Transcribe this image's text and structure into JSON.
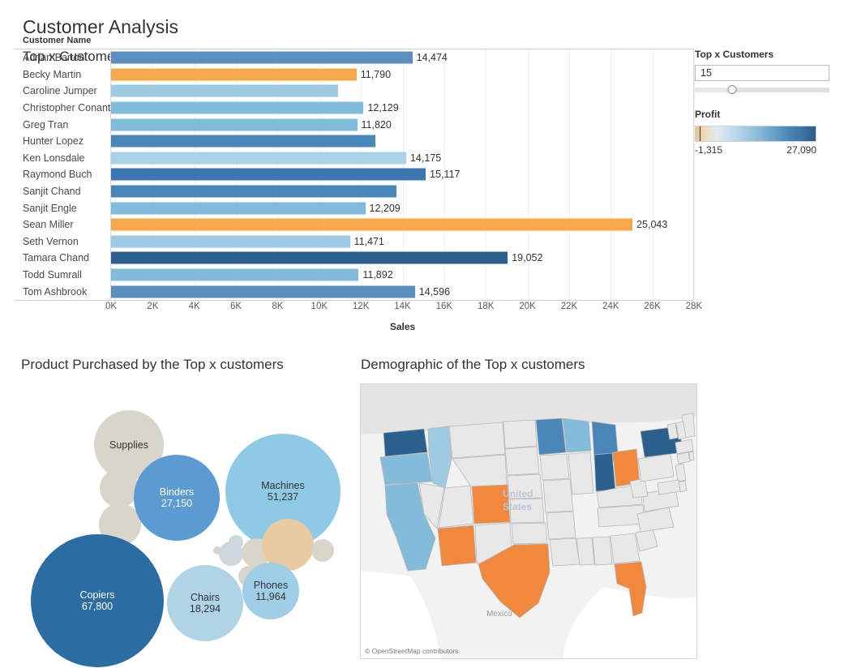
{
  "dashboard": {
    "title": "Customer Analysis"
  },
  "bar_panel": {
    "title": "Top x Customers",
    "column_header": "Customer Name",
    "axis_title": "Sales"
  },
  "controls": {
    "parameter_label": "Top x Customers",
    "parameter_value": "15",
    "legend_label": "Profit",
    "legend_min": "-1,315",
    "legend_max": "27,090"
  },
  "bubble_panel": {
    "title": "Product Purchased by the Top x customers"
  },
  "map_panel": {
    "title": "Demographic of the Top x customers",
    "attribution": "© OpenStreetMap contributors",
    "country_label_line1": "United",
    "country_label_line2": "States",
    "mexico_label": "Mexico"
  },
  "chart_data": [
    {
      "type": "bar",
      "title": "Top x Customers",
      "xlabel": "Sales",
      "ylabel": "Customer Name",
      "xlim": [
        0,
        28000
      ],
      "grid": true,
      "orientation": "horizontal",
      "ticks": [
        "0K",
        "2K",
        "4K",
        "6K",
        "8K",
        "10K",
        "12K",
        "14K",
        "16K",
        "18K",
        "20K",
        "22K",
        "24K",
        "26K",
        "28K"
      ],
      "tick_values": [
        0,
        2000,
        4000,
        6000,
        8000,
        10000,
        12000,
        14000,
        16000,
        18000,
        20000,
        22000,
        24000,
        26000,
        28000
      ],
      "color_encoding": "Profit",
      "categories": [
        "Adrian Barton",
        "Becky Martin",
        "Caroline Jumper",
        "Christopher Conant",
        "Greg Tran",
        "Hunter Lopez",
        "Ken Lonsdale",
        "Raymond Buch",
        "Sanjit Chand",
        "Sanjit Engle",
        "Sean Miller",
        "Seth Vernon",
        "Tamara Chand",
        "Todd Sumrall",
        "Tom Ashbrook"
      ],
      "values": [
        14474,
        11790,
        10900,
        12129,
        11820,
        12700,
        14175,
        15117,
        13700,
        12209,
        25043,
        11471,
        19052,
        11892,
        14596
      ],
      "labels": [
        "14,474",
        "11,790",
        "",
        "12,129",
        "11,820",
        "",
        "14,175",
        "15,117",
        "",
        "12,209",
        "25,043",
        "11,471",
        "19,052",
        "11,892",
        "14,596"
      ],
      "colors": [
        "#5b8fc0",
        "#f5a council",
        "#9ecae3",
        "#82bcdb",
        "#82bcdb",
        "#4a86b8",
        "#a8d3e8",
        "#3a77ae",
        "#4a86b8",
        "#82bcdb",
        "#f7a84a",
        "#9ecae3",
        "#2b5f8e",
        "#82bcdb",
        "#5b8fc0"
      ],
      "bar_colors": [
        "#5b8fc0",
        "#f7a84a",
        "#9ecae3",
        "#82bcdb",
        "#82bcdb",
        "#4a86b8",
        "#a8d3e8",
        "#3a77ae",
        "#4a86b8",
        "#82bcdb",
        "#f7a84a",
        "#9ecae3",
        "#2b5f8e",
        "#82bcdb",
        "#5b8fc0"
      ]
    },
    {
      "type": "bubble",
      "title": "Product Purchased by the Top x customers",
      "labeled_bubbles": [
        {
          "name": "Copiers",
          "value": 67800,
          "label": "67,800",
          "color": "#2b6ca3"
        },
        {
          "name": "Machines",
          "value": 51237,
          "label": "51,237",
          "color": "#8ecae6"
        },
        {
          "name": "Binders",
          "value": 27150,
          "label": "27,150",
          "color": "#5b9bd1"
        },
        {
          "name": "Chairs",
          "value": 18294,
          "label": "18,294",
          "color": "#aed4e6"
        },
        {
          "name": "Phones",
          "value": 11964,
          "label": "11,964",
          "color": "#9ecfe6"
        },
        {
          "name": "Supplies",
          "value": 0,
          "label": "",
          "color": "#d8d5cb"
        }
      ]
    },
    {
      "type": "map",
      "title": "Demographic of the Top x customers",
      "region": "United States",
      "color_encoding": "Profit",
      "states": [
        {
          "code": "WA",
          "color": "#2b5f8e"
        },
        {
          "code": "NY",
          "color": "#2b5f8e"
        },
        {
          "code": "IN",
          "color": "#2b5f8e"
        },
        {
          "code": "MN",
          "color": "#4a86b8"
        },
        {
          "code": "MI",
          "color": "#4a86b8"
        },
        {
          "code": "WI",
          "color": "#82bcdb"
        },
        {
          "code": "OR",
          "color": "#82bcdb"
        },
        {
          "code": "ID",
          "color": "#9ecae3"
        },
        {
          "code": "CA",
          "color": "#82bcdb"
        },
        {
          "code": "TX",
          "color": "#f0883e"
        },
        {
          "code": "AZ",
          "color": "#f0883e"
        },
        {
          "code": "CO",
          "color": "#f0883e"
        },
        {
          "code": "OH",
          "color": "#f0883e"
        },
        {
          "code": "FL",
          "color": "#f0883e"
        }
      ]
    }
  ]
}
